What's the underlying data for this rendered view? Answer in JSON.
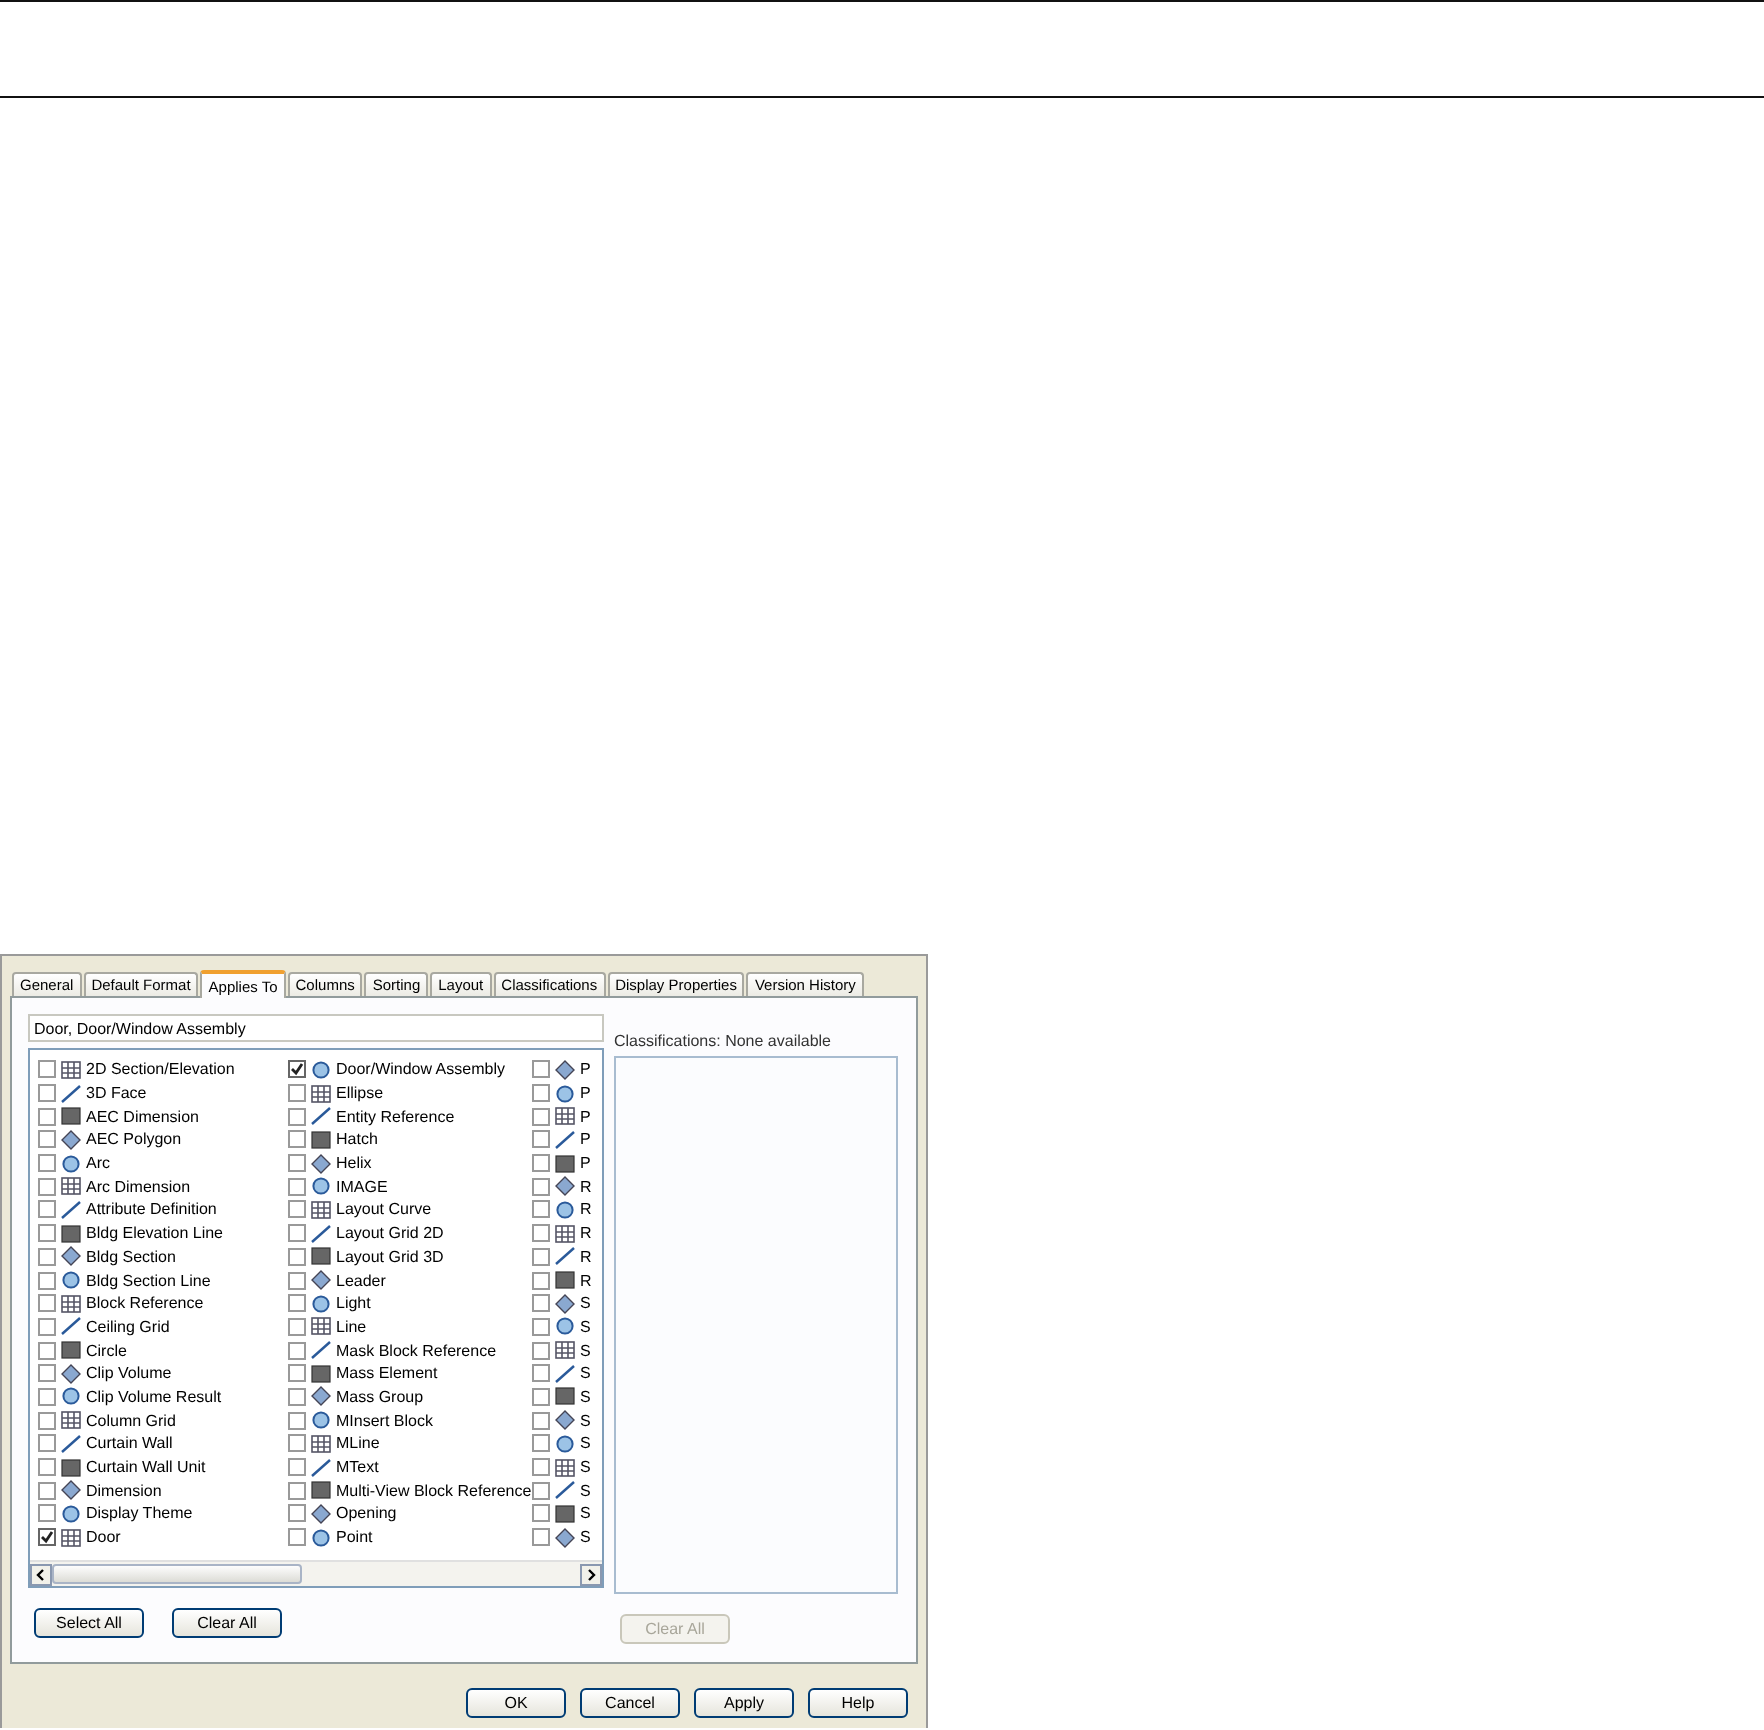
{
  "tabs": [
    {
      "label": "General",
      "selected": false
    },
    {
      "label": "Default Format",
      "selected": false
    },
    {
      "label": "Applies To",
      "selected": true
    },
    {
      "label": "Columns",
      "selected": false
    },
    {
      "label": "Sorting",
      "selected": false
    },
    {
      "label": "Layout",
      "selected": false
    },
    {
      "label": "Classifications",
      "selected": false
    },
    {
      "label": "Display Properties",
      "selected": false
    },
    {
      "label": "Version History",
      "selected": false
    }
  ],
  "selection_field": {
    "value": "Door, Door/Window Assembly"
  },
  "object_columns": [
    [
      {
        "label": "2D Section/Elevation",
        "checked": false
      },
      {
        "label": "3D Face",
        "checked": false
      },
      {
        "label": "AEC Dimension",
        "checked": false
      },
      {
        "label": "AEC Polygon",
        "checked": false
      },
      {
        "label": "Arc",
        "checked": false
      },
      {
        "label": "Arc Dimension",
        "checked": false
      },
      {
        "label": "Attribute Definition",
        "checked": false
      },
      {
        "label": "Bldg Elevation Line",
        "checked": false
      },
      {
        "label": "Bldg Section",
        "checked": false
      },
      {
        "label": "Bldg Section Line",
        "checked": false
      },
      {
        "label": "Block Reference",
        "checked": false
      },
      {
        "label": "Ceiling Grid",
        "checked": false
      },
      {
        "label": "Circle",
        "checked": false
      },
      {
        "label": "Clip Volume",
        "checked": false
      },
      {
        "label": "Clip Volume Result",
        "checked": false
      },
      {
        "label": "Column Grid",
        "checked": false
      },
      {
        "label": "Curtain Wall",
        "checked": false
      },
      {
        "label": "Curtain Wall Unit",
        "checked": false
      },
      {
        "label": "Dimension",
        "checked": false
      },
      {
        "label": "Display Theme",
        "checked": false
      },
      {
        "label": "Door",
        "checked": true
      }
    ],
    [
      {
        "label": "Door/Window Assembly",
        "checked": true
      },
      {
        "label": "Ellipse",
        "checked": false
      },
      {
        "label": "Entity Reference",
        "checked": false
      },
      {
        "label": "Hatch",
        "checked": false
      },
      {
        "label": "Helix",
        "checked": false
      },
      {
        "label": "IMAGE",
        "checked": false
      },
      {
        "label": "Layout Curve",
        "checked": false
      },
      {
        "label": "Layout Grid 2D",
        "checked": false
      },
      {
        "label": "Layout Grid 3D",
        "checked": false
      },
      {
        "label": "Leader",
        "checked": false
      },
      {
        "label": "Light",
        "checked": false
      },
      {
        "label": "Line",
        "checked": false
      },
      {
        "label": "Mask Block Reference",
        "checked": false
      },
      {
        "label": "Mass Element",
        "checked": false
      },
      {
        "label": "Mass Group",
        "checked": false
      },
      {
        "label": "MInsert Block",
        "checked": false
      },
      {
        "label": "MLine",
        "checked": false
      },
      {
        "label": "MText",
        "checked": false
      },
      {
        "label": "Multi-View Block Reference",
        "checked": false
      },
      {
        "label": "Opening",
        "checked": false
      },
      {
        "label": "Point",
        "checked": false
      }
    ],
    [
      {
        "label": "P",
        "checked": false
      },
      {
        "label": "P",
        "checked": false
      },
      {
        "label": "P",
        "checked": false
      },
      {
        "label": "P",
        "checked": false
      },
      {
        "label": "P",
        "checked": false
      },
      {
        "label": "R",
        "checked": false
      },
      {
        "label": "R",
        "checked": false
      },
      {
        "label": "R",
        "checked": false
      },
      {
        "label": "R",
        "checked": false
      },
      {
        "label": "R",
        "checked": false
      },
      {
        "label": "S",
        "checked": false
      },
      {
        "label": "S",
        "checked": false
      },
      {
        "label": "S",
        "checked": false
      },
      {
        "label": "S",
        "checked": false
      },
      {
        "label": "S",
        "checked": false
      },
      {
        "label": "S",
        "checked": false
      },
      {
        "label": "S",
        "checked": false
      },
      {
        "label": "S",
        "checked": false
      },
      {
        "label": "S",
        "checked": false
      },
      {
        "label": "S",
        "checked": false
      },
      {
        "label": "S",
        "checked": false
      }
    ]
  ],
  "list_buttons": [
    {
      "label": "Select All",
      "disabled": false
    },
    {
      "label": "Clear All",
      "disabled": false
    }
  ],
  "classifications_label": "Classifications: None available",
  "classifications_button": {
    "label": "Clear All",
    "disabled": true
  },
  "footer_buttons": [
    {
      "label": "OK",
      "disabled": false
    },
    {
      "label": "Cancel",
      "disabled": false
    },
    {
      "label": "Apply",
      "disabled": false
    },
    {
      "label": "Help",
      "disabled": false
    }
  ]
}
